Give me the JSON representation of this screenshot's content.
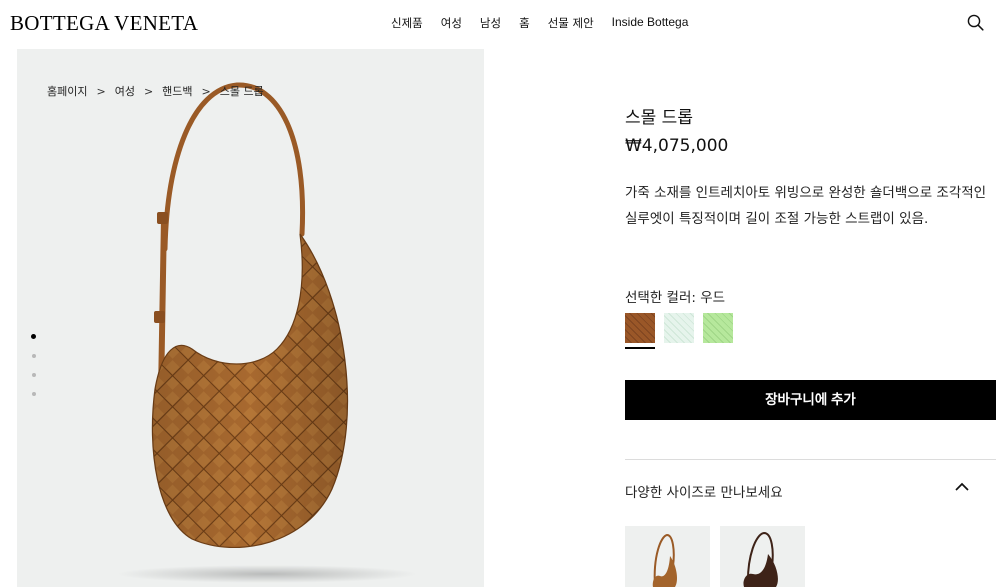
{
  "header": {
    "logo": "BOTTEGA VENETA",
    "nav": [
      "신제품",
      "여성",
      "남성",
      "홈",
      "선물 제안",
      "Inside Bottega"
    ],
    "search_icon": "search-icon"
  },
  "gallery": {
    "breadcrumb": [
      "홈페이지",
      "여성",
      "핸드백",
      "스몰 드롭"
    ],
    "breadcrumb_separator": ">",
    "image_count": 4,
    "active_index": 0,
    "bag_color": "#a3642c"
  },
  "product": {
    "title": "스몰 드롭",
    "price": "₩4,075,000",
    "description": "가죽 소재를 인트레치아토 위빙으로 완성한 숄더백으로 조각적인 실루엣이 특징적이며 길이 조절 가능한 스트랩이 있음.",
    "color_label": "선택한 컬러: 우드",
    "swatches": [
      {
        "name": "우드",
        "color": "#9a5728",
        "selected": true
      },
      {
        "name": "light-mint",
        "color": "#e4f3ea",
        "selected": false
      },
      {
        "name": "lime",
        "color": "#b4e69a",
        "selected": false
      }
    ],
    "add_to_cart": "장바구니에 추가",
    "sizes_label": "다양한 사이즈로 만나보세요",
    "size_thumbnails": [
      {
        "color": "#a3642c"
      },
      {
        "color": "#3e2318"
      }
    ]
  }
}
